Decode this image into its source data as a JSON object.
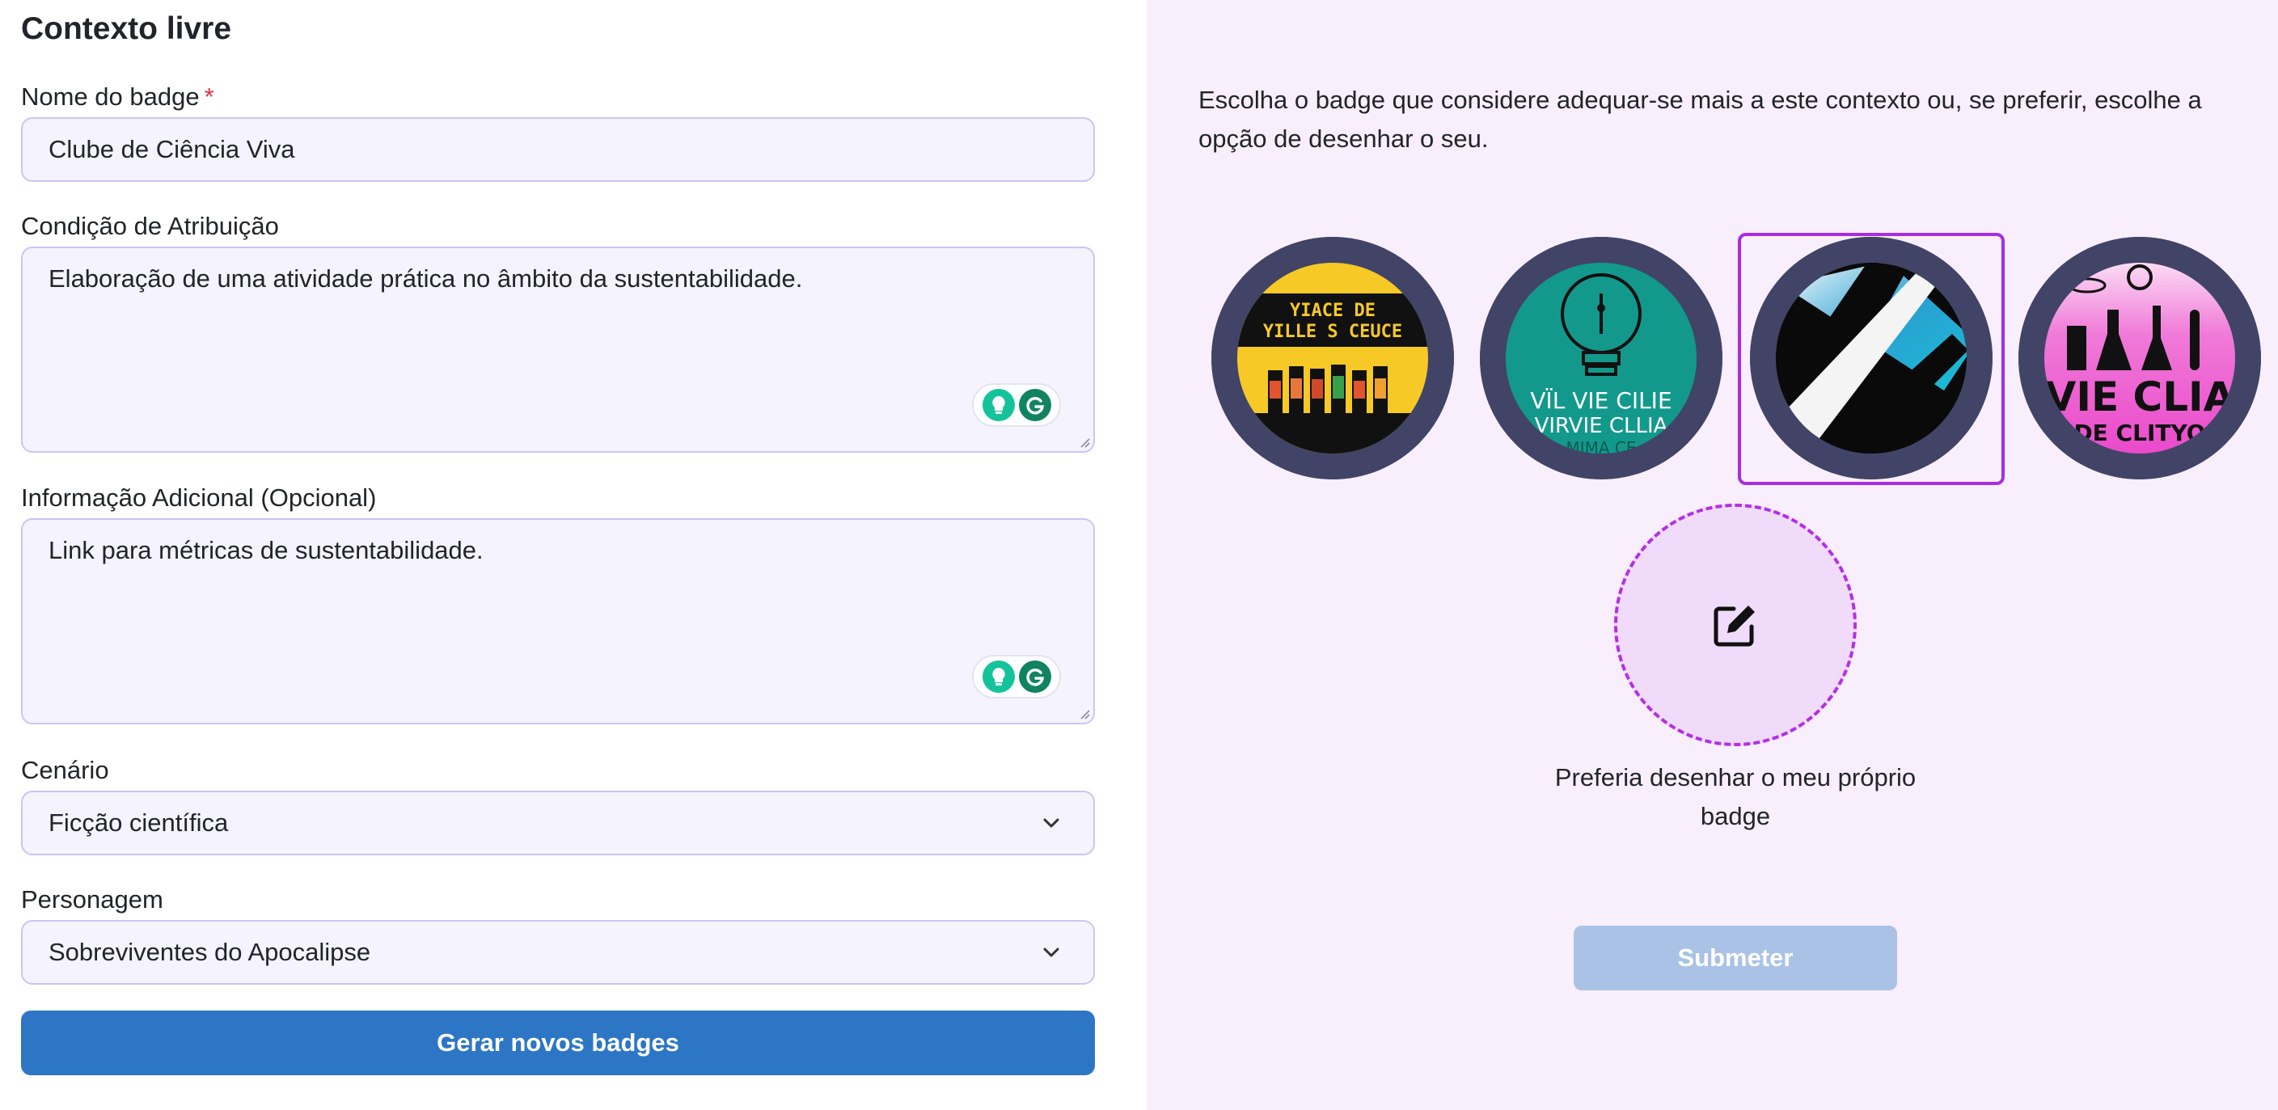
{
  "form": {
    "title": "Contexto livre",
    "badge_name": {
      "label": "Nome do badge",
      "required_mark": "*",
      "value": "Clube de Ciência Viva"
    },
    "condition": {
      "label": "Condição de Atribuição",
      "value": "Elaboração de uma atividade prática no âmbito da sustentabilidade."
    },
    "additional": {
      "label": "Informação Adicional (Opcional)",
      "value": "Link para métricas de sustentabilidade."
    },
    "scenario": {
      "label": "Cenário",
      "value": "Ficção científica"
    },
    "character": {
      "label": "Personagem",
      "value": "Sobreviventes do Apocalipse"
    },
    "generate_button": "Gerar novos badges"
  },
  "panel": {
    "intro": "Escolha o badge que considere adequar-se mais a este contexto ou, se preferir, escolhe a opção de desenhar o seu.",
    "badges": [
      {
        "lines": [
          "YIACE DE",
          "YILLE S CEUCE"
        ],
        "selected": false
      },
      {
        "lines": [
          "VÏL VIE CILIE",
          "VIRVIE CLLIA",
          "MIMA CE"
        ],
        "selected": false
      },
      {
        "lines": [],
        "selected": true
      },
      {
        "lines": [
          "VIE CLIA",
          "DE CLITYO"
        ],
        "selected": false
      }
    ],
    "draw_own": "Preferia desenhar o meu próprio badge",
    "submit_button": "Submeter"
  },
  "colors": {
    "primary": "#2c76c5",
    "accent": "#a62ee0",
    "panel_bg": "#f9eefc",
    "field_bg": "#f4f3fe",
    "badge_ring": "#414466"
  },
  "icons": [
    "chevron-down-icon",
    "grammarly-icon",
    "bulb-icon",
    "edit-icon"
  ]
}
